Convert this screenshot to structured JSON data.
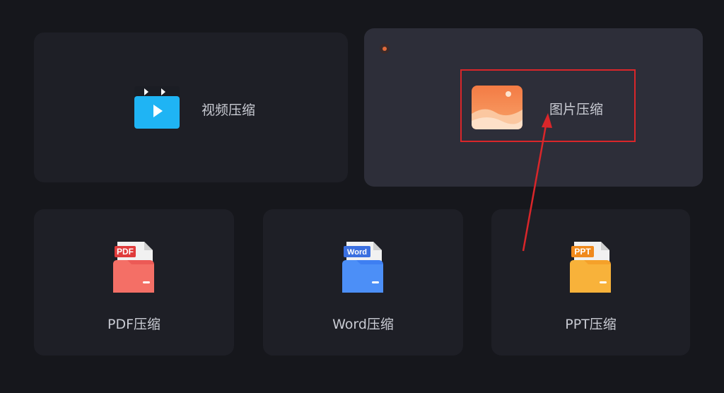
{
  "cards": {
    "video": {
      "label": "视频压缩",
      "icon": "video-clapper-icon"
    },
    "image": {
      "label": "图片压缩",
      "icon": "image-icon",
      "selected": true
    },
    "pdf": {
      "label": "PDF压缩",
      "icon": "pdf-folder-icon",
      "badge": "PDF"
    },
    "word": {
      "label": "Word压缩",
      "icon": "word-folder-icon",
      "badge": "Word"
    },
    "ppt": {
      "label": "PPT压缩",
      "icon": "ppt-folder-icon",
      "badge": "PPT"
    }
  },
  "colors": {
    "background": "#16171c",
    "card": "#1e1f26",
    "card_active": "#2d2e39",
    "annotation_red": "#d9262a"
  }
}
